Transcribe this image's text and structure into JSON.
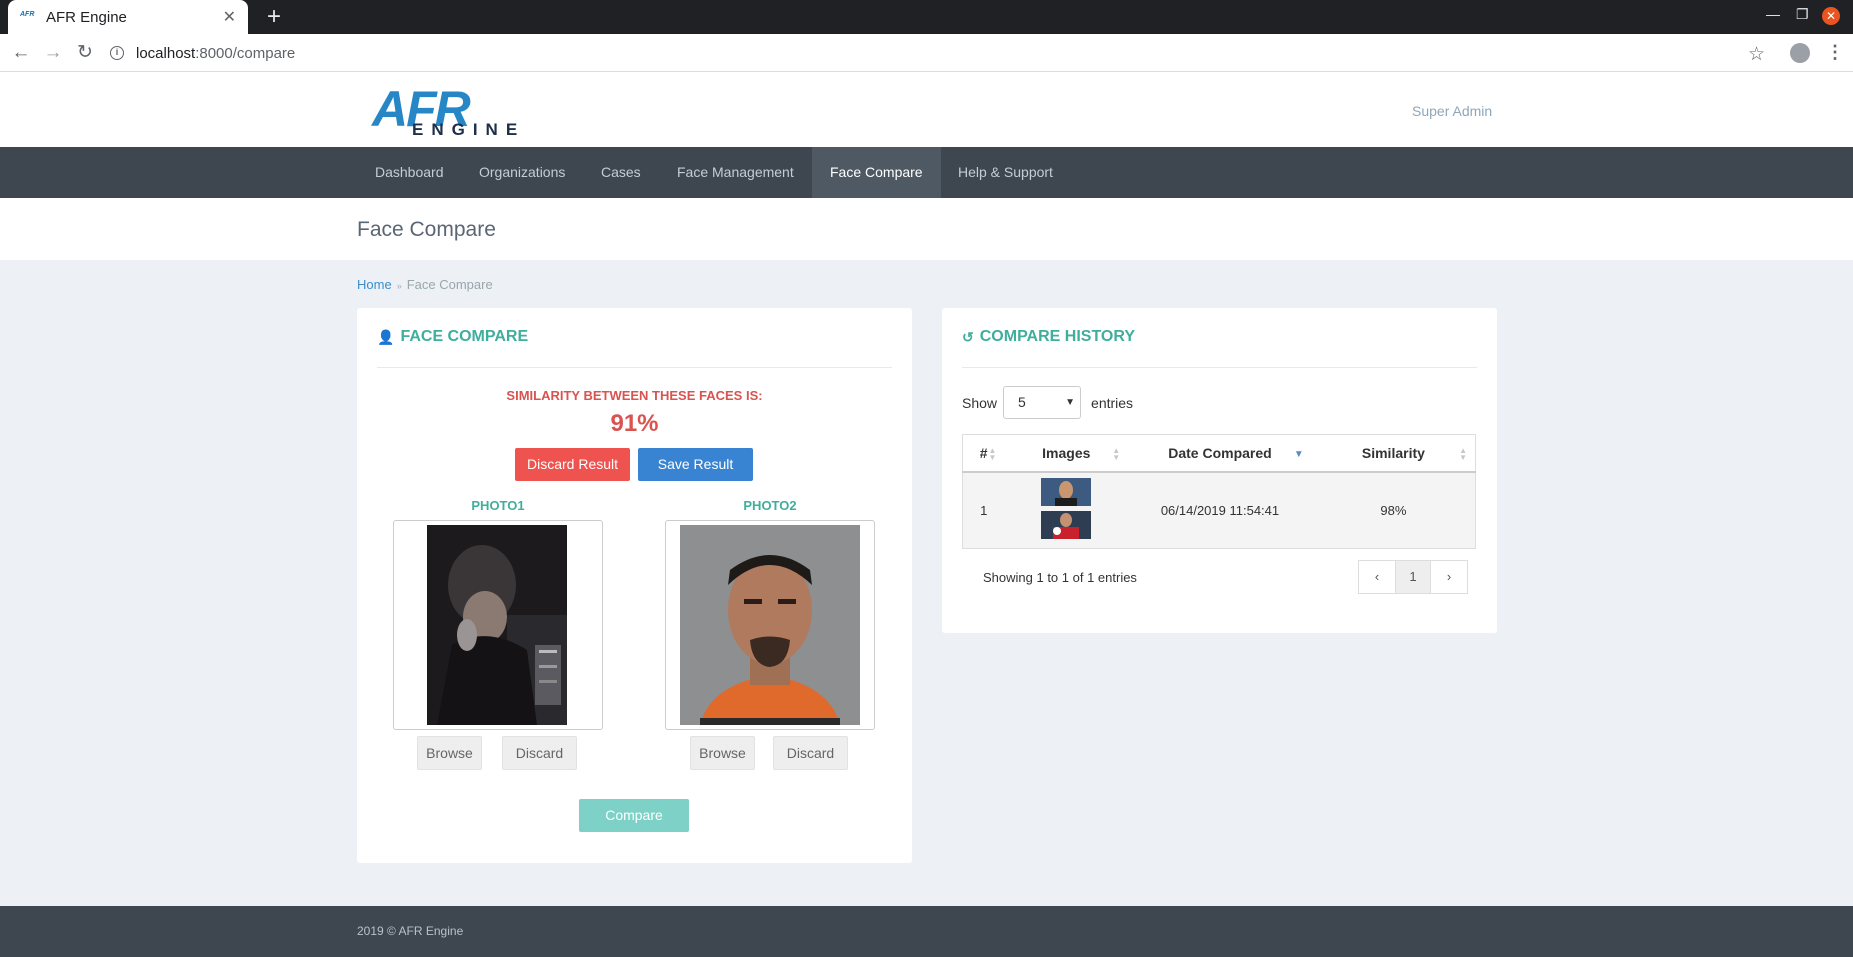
{
  "browser": {
    "tab_title": "AFR Engine",
    "favicon_text": "AFR",
    "url_host": "localhost",
    "url_path": ":8000/compare"
  },
  "header": {
    "logo_top": "AFR",
    "logo_bottom": "ENGINE",
    "user": "Super Admin"
  },
  "nav": {
    "items": [
      "Dashboard",
      "Organizations",
      "Cases",
      "Face Management",
      "Face Compare",
      "Help & Support"
    ],
    "active": "Face Compare"
  },
  "page": {
    "title": "Face Compare",
    "breadcrumb": {
      "home": "Home",
      "current": "Face Compare"
    }
  },
  "compare": {
    "title": "FACE COMPARE",
    "similarity_label": "SIMILARITY BETWEEN THESE FACES IS:",
    "similarity_value": "91%",
    "discard_result": "Discard Result",
    "save_result": "Save Result",
    "photo1_label": "PHOTO1",
    "photo2_label": "PHOTO2",
    "browse": "Browse",
    "discard": "Discard",
    "compare_button": "Compare"
  },
  "history": {
    "title": "COMPARE HISTORY",
    "show_label": "Show",
    "entries_label": "entries",
    "page_size": "5",
    "columns": [
      "#",
      "Images",
      "Date Compared",
      "Similarity"
    ],
    "rows": [
      {
        "index": "1",
        "date": "06/14/2019 11:54:41",
        "similarity": "98%"
      }
    ],
    "showing_text": "Showing 1 to 1 of 1 entries",
    "current_page": "1",
    "prev": "‹",
    "next": "›"
  },
  "footer": {
    "text": "2019 © AFR Engine"
  },
  "colors": {
    "accent_teal": "#3fae9d",
    "danger": "#ef5350",
    "primary": "#3884d3",
    "nav_bg": "#3e4650"
  }
}
